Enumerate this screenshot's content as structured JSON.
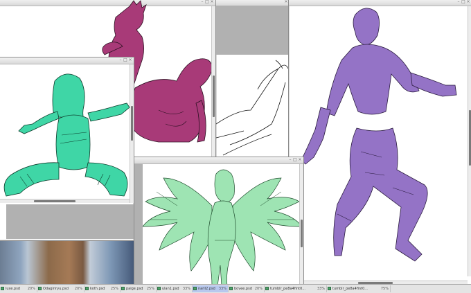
{
  "taskbar": {
    "tabs": [
      {
        "file": "luxe.psd",
        "zoom": "20%"
      },
      {
        "file": "Odagiriryu.psd",
        "zoom": "20%"
      },
      {
        "file": "koth.psd",
        "zoom": "25%"
      },
      {
        "file": "paige.psd",
        "zoom": "25%"
      },
      {
        "file": "ulan1.psd",
        "zoom": "33%"
      },
      {
        "file": "naril2.psd",
        "zoom": "33%"
      },
      {
        "file": "bovee.psd",
        "zoom": "20%"
      },
      {
        "file": "tumblr_pe8a4fint0...",
        "zoom": "33%"
      },
      {
        "file": "tumblr_pe8a4fint0...",
        "zoom": "75%"
      }
    ]
  },
  "windows": {
    "magenta": {
      "title": ""
    },
    "teal": {
      "title": ""
    },
    "lineart": {
      "title": ""
    },
    "purple": {
      "title": ""
    },
    "green": {
      "title": ""
    }
  },
  "colors": {
    "magenta": "#a83a78",
    "teal": "#3fd6a6",
    "purple": "#9473c6",
    "green": "#9ee4b3",
    "canvas_gray": "#b1b1b1"
  }
}
